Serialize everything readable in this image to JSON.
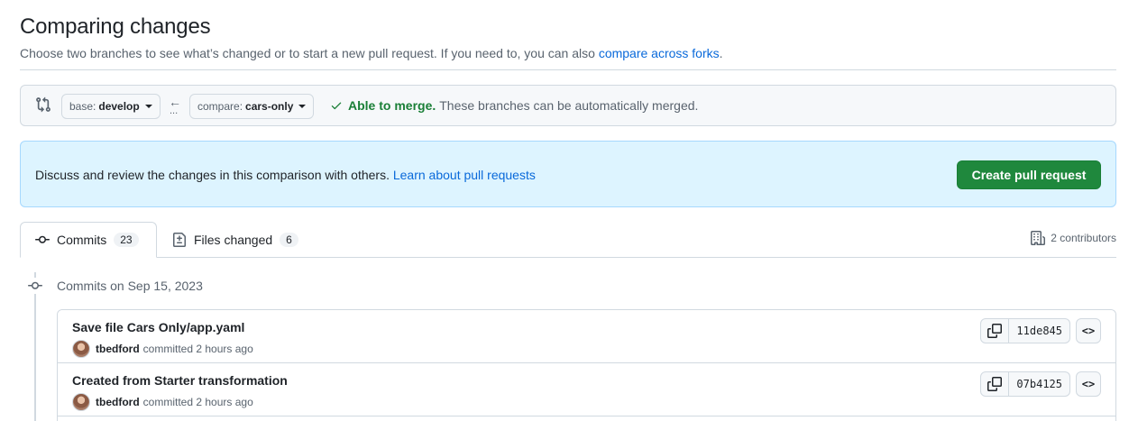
{
  "header": {
    "title": "Comparing changes",
    "subtitle": "Choose two branches to see what’s changed or to start a new pull request. If you need to, you can also",
    "subtitle_link": "compare across forks",
    "subtitle_end": "."
  },
  "range": {
    "base_prefix": "base:",
    "base_branch": "develop",
    "compare_prefix": "compare:",
    "compare_branch": "cars-only",
    "arrow": "←",
    "dots": "...",
    "merge_ok": "Able to merge.",
    "merge_text": "These branches can be automatically merged."
  },
  "flash": {
    "text": "Discuss and review the changes in this comparison with others.",
    "link": "Learn about pull requests",
    "button": "Create pull request"
  },
  "tabs": [
    {
      "label": "Commits",
      "count": "23"
    },
    {
      "label": "Files changed",
      "count": "6"
    }
  ],
  "contributors": "2 contributors",
  "timeline": {
    "date_label": "Commits on Sep 15, 2023"
  },
  "commits": [
    {
      "title": "Save file Cars Only/app.yaml",
      "author": "tbedford",
      "action": "committed",
      "time": "2 hours ago",
      "sha": "11de845",
      "browse": "<>"
    },
    {
      "title": "Created from Starter transformation",
      "author": "tbedford",
      "action": "committed",
      "time": "2 hours ago",
      "sha": "07b4125",
      "browse": "<>"
    }
  ],
  "colors": {
    "accent_link": "#0969da",
    "success": "#1a7f37",
    "button_green": "#1f883d",
    "flash_bg": "#ddf4ff"
  }
}
